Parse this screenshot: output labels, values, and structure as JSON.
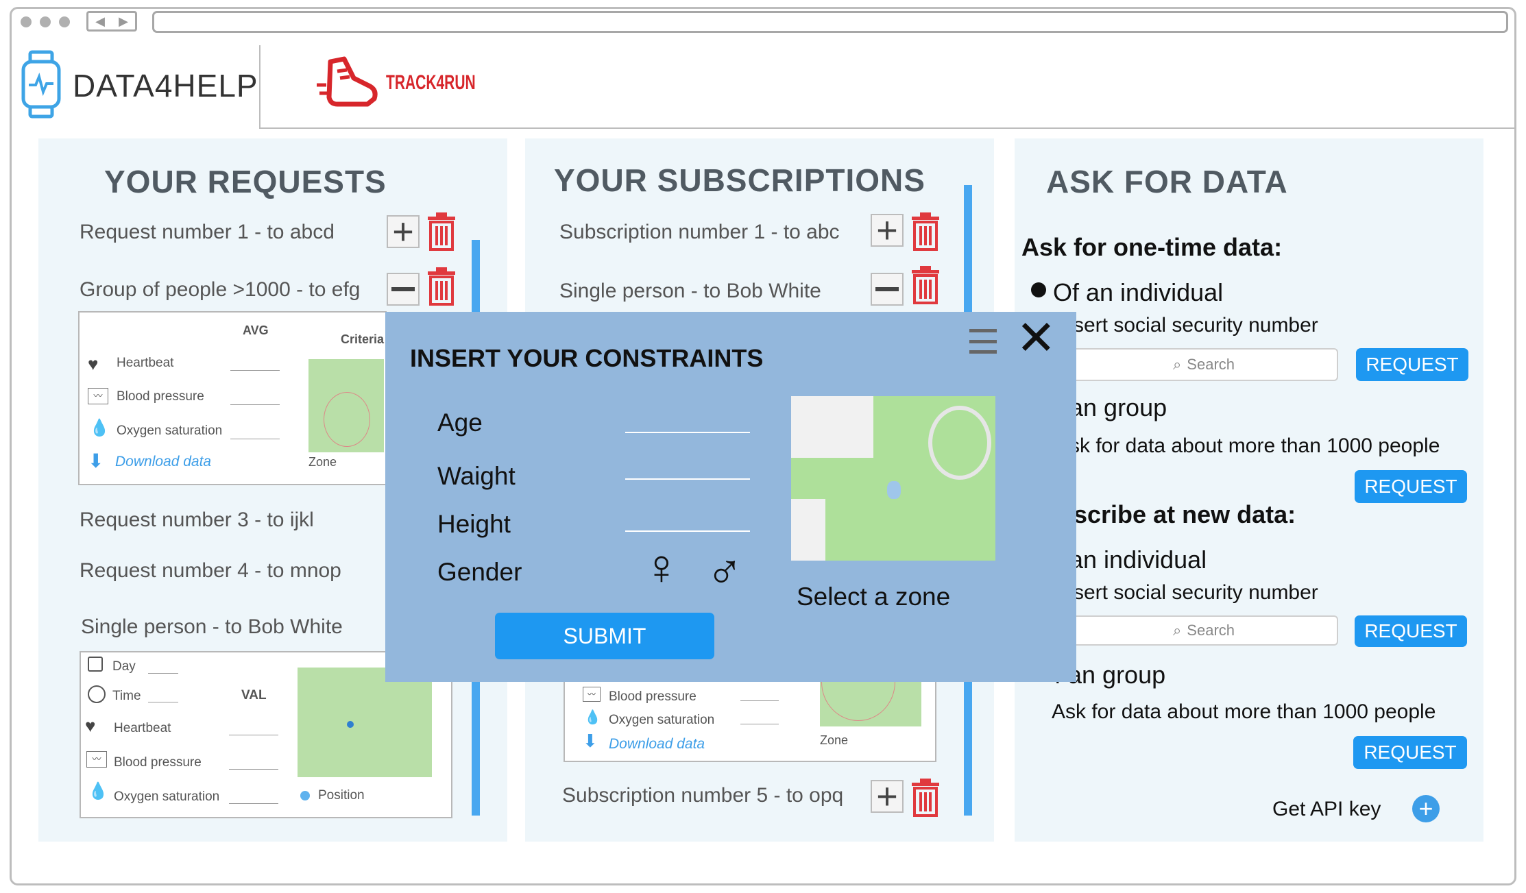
{
  "header": {
    "brand": "DATA4HELP",
    "partner": "TRACK4RUN"
  },
  "requests": {
    "title": "YOUR REQUESTS",
    "row1": "Request number 1 - to abcd",
    "row2": "Group of people >1000 - to efg",
    "card1": {
      "avg": "AVG",
      "criteria": "Criteria",
      "heartbeat": "Heartbeat",
      "blood": "Blood pressure",
      "oxygen": "Oxygen saturation",
      "download": "Download data",
      "zone": "Zone"
    },
    "row3": "Request number 3 - to ijkl",
    "row4": "Request number 4 - to mnop",
    "row5": "Single person - to Bob White",
    "card2": {
      "day": "Day",
      "time": "Time",
      "val": "VAL",
      "heartbeat": "Heartbeat",
      "blood": "Blood pressure",
      "oxygen": "Oxygen saturation",
      "position": "Position"
    }
  },
  "subscriptions": {
    "title": "YOUR SUBSCRIPTIONS",
    "row1": "Subscription number 1 - to abc",
    "row2": "Single person - to Bob White",
    "card": {
      "blood": "Blood pressure",
      "oxygen": "Oxygen saturation",
      "download": "Download data",
      "zone": "Zone"
    },
    "row5": "Subscription number 5 - to opq"
  },
  "ask": {
    "title": "ASK FOR DATA",
    "onetime": "Ask for one-time data:",
    "individual1": "Of an individual",
    "insert1": "sert social security number",
    "search1": "Search",
    "request": "REQUEST",
    "group1": "f an group",
    "more1": "sk for data about more than 1000 people",
    "subscribe": "scribe at new data:",
    "individual2": "f an individual",
    "insert2": "sert social security number",
    "search2": "Search",
    "group2": "f an group",
    "more2": "Ask for data about more than 1000 people",
    "apikey": "Get API key"
  },
  "modal": {
    "title": "INSERT YOUR CONSTRAINTS",
    "age": "Age",
    "weight": "Waight",
    "height": "Height",
    "gender": "Gender",
    "submit": "SUBMIT",
    "zone": "Select a zone"
  },
  "colors": {
    "accent": "#1e98f1",
    "panel": "#eef6fa",
    "modal": "#93b7dc",
    "trash": "#e0393e",
    "brandRed": "#d7262b"
  }
}
